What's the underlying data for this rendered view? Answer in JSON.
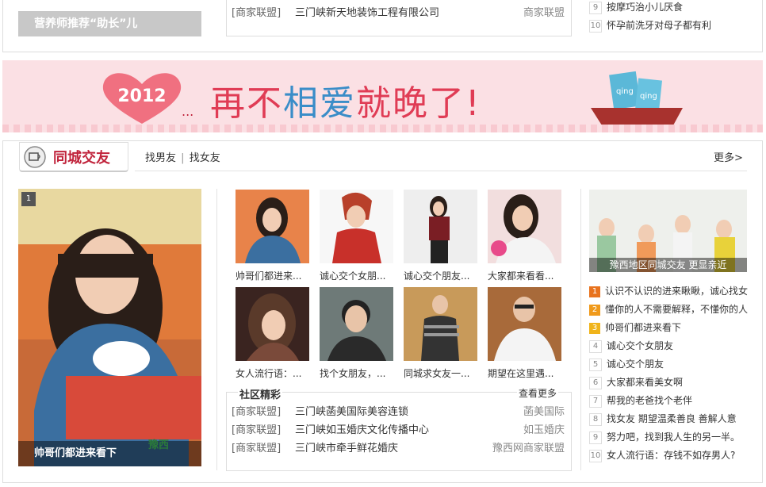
{
  "top": {
    "promo_label": "营养师推荐“助长”儿",
    "partners": [
      {
        "tag": "[商家联盟]",
        "name": "三门峡新天地装饰工程有限公司",
        "source": "商家联盟"
      }
    ],
    "rank": [
      {
        "num": "9",
        "text": "按摩巧治小儿厌食"
      },
      {
        "num": "10",
        "text": "怀孕前洗牙对母子都有利"
      }
    ]
  },
  "banner": {
    "year": "2012",
    "slogan_pre": "再不",
    "slogan_mid": "相爱",
    "slogan_post": "就晚了!",
    "stamp_1": "qing",
    "stamp_2": "qing"
  },
  "section": {
    "title": "同城交友",
    "sub_link_1": "找男友",
    "divider": "|",
    "sub_link_2": "找女友",
    "more": "更多>"
  },
  "feature": {
    "index": "1",
    "caption": "帅哥们都进来看下",
    "watermark": "豫西"
  },
  "thumbs": [
    {
      "caption": "帅哥们都进来..."
    },
    {
      "caption": "诚心交个女朋..."
    },
    {
      "caption": "诚心交个朋友..."
    },
    {
      "caption": "大家都来看看..."
    },
    {
      "caption": "女人流行语：..."
    },
    {
      "caption": "找个女朋友，..."
    },
    {
      "caption": "同城求女友一..."
    },
    {
      "caption": "期望在这里遇..."
    }
  ],
  "community": {
    "title": "社区精彩",
    "more": "查看更多",
    "rows": [
      {
        "tag": "[商家联盟]",
        "name": "三门峡菡美国际美容连锁",
        "source": "菡美国际"
      },
      {
        "tag": "[商家联盟]",
        "name": "三门峡如玉婚庆文化传播中心",
        "source": "如玉婚庆"
      },
      {
        "tag": "[商家联盟]",
        "name": "三门峡市牵手鲜花婚庆",
        "source": "豫西网商家联盟"
      }
    ]
  },
  "side": {
    "photo_caption": "豫西地区同城交友 更显亲近",
    "rank": [
      {
        "num": "1",
        "text": "认识不认识的进来瞅瞅，诚心找女"
      },
      {
        "num": "2",
        "text": "懂你的人不需要解释，不懂你的人"
      },
      {
        "num": "3",
        "text": "帅哥们都进来看下"
      },
      {
        "num": "4",
        "text": "诚心交个女朋友"
      },
      {
        "num": "5",
        "text": "诚心交个朋友"
      },
      {
        "num": "6",
        "text": "大家都来看美女啊"
      },
      {
        "num": "7",
        "text": "帮我的老爸找个老伴"
      },
      {
        "num": "8",
        "text": "找女友 期望温柔善良 善解人意"
      },
      {
        "num": "9",
        "text": "努力吧，找到我人生的另一半。"
      },
      {
        "num": "10",
        "text": "女人流行语：存钱不如存男人?"
      }
    ]
  },
  "colors": {
    "accent_red": "#c0233b",
    "rank_1": "#e8731e",
    "rank_2": "#f09a1b",
    "rank_3": "#f0b41b",
    "banner_bg": "#fbe0e4"
  }
}
